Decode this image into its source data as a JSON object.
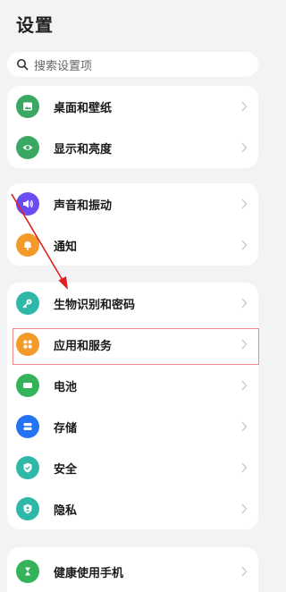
{
  "page": {
    "title": "设置"
  },
  "search": {
    "placeholder": "搜索设置项"
  },
  "groups": [
    {
      "items": [
        {
          "label": "桌面和壁纸",
          "icon": "wallpaper-icon",
          "color": "#3aa862"
        },
        {
          "label": "显示和亮度",
          "icon": "eye-icon",
          "color": "#3aa862"
        }
      ]
    },
    {
      "items": [
        {
          "label": "声音和振动",
          "icon": "speaker-icon",
          "color": "#6b4cf1"
        },
        {
          "label": "通知",
          "icon": "bell-icon",
          "color": "#f39a2b"
        }
      ]
    },
    {
      "items": [
        {
          "label": "生物识别和密码",
          "icon": "key-icon",
          "color": "#2fb8a8"
        },
        {
          "label": "应用和服务",
          "icon": "apps-icon",
          "color": "#f39a2b"
        },
        {
          "label": "电池",
          "icon": "battery-icon",
          "color": "#34b35a"
        },
        {
          "label": "存储",
          "icon": "storage-icon",
          "color": "#2473f2"
        },
        {
          "label": "安全",
          "icon": "shield-check-icon",
          "color": "#2fb8a8"
        },
        {
          "label": "隐私",
          "icon": "privacy-icon",
          "color": "#2fb8a8"
        }
      ]
    },
    {
      "items": [
        {
          "label": "健康使用手机",
          "icon": "hourglass-icon",
          "color": "#34b35a"
        }
      ]
    }
  ],
  "annotation": {
    "arrow_color": "#e02020",
    "highlight_color": "#f08a8a"
  }
}
